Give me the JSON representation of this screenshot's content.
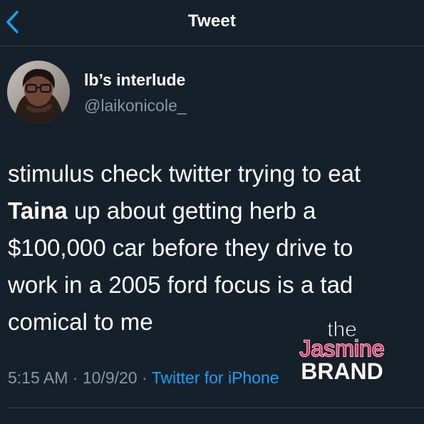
{
  "header": {
    "title": "Tweet",
    "back_icon": "chevron-left-icon"
  },
  "author": {
    "display_name": "lb’s interlude",
    "handle": "@laikonicole_"
  },
  "tweet": {
    "line1": "stimulus check twitter trying to eat",
    "mention": "Taina",
    "line2_rest": " up about getting herb a",
    "line3": "$100,000 car before they drive to",
    "line4": "work in a 2005 ford focus is a tad",
    "line5": "comical to me"
  },
  "meta": {
    "time": "5:15 AM",
    "separator1": " · ",
    "date": "10/9/20",
    "separator2": " · ",
    "source": "Twitter for iPhone"
  },
  "watermark": {
    "line1": "the",
    "line2": "Jasmine",
    "line3": "BRAND"
  },
  "colors": {
    "background": "#15202b",
    "accent": "#1da1f2",
    "muted": "#8899a6",
    "watermark": "#e8316a"
  }
}
